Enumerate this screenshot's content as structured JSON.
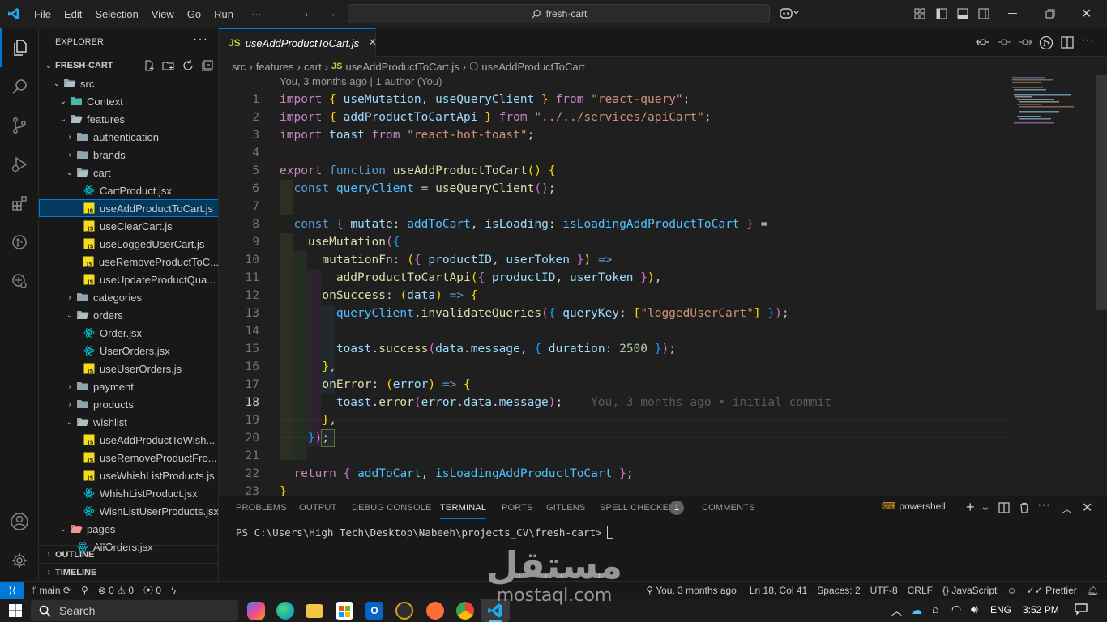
{
  "menu": [
    "File",
    "Edit",
    "Selection",
    "View",
    "Go",
    "Run",
    "···"
  ],
  "search": {
    "text": "fresh-cart"
  },
  "explorer": {
    "title": "EXPLORER",
    "project": "FRESH-CART",
    "outline": "OUTLINE",
    "timeline": "TIMELINE",
    "tree": [
      {
        "label": "src",
        "depth": 0,
        "type": "folder-open"
      },
      {
        "label": "Context",
        "depth": 1,
        "type": "folder-collapsed-ctx"
      },
      {
        "label": "features",
        "depth": 1,
        "type": "folder-open"
      },
      {
        "label": "authentication",
        "depth": 2,
        "type": "folder"
      },
      {
        "label": "brands",
        "depth": 2,
        "type": "folder"
      },
      {
        "label": "cart",
        "depth": 2,
        "type": "folder-open"
      },
      {
        "label": "CartProduct.jsx",
        "depth": 3,
        "type": "react"
      },
      {
        "label": "useAddProductToCart.js",
        "depth": 3,
        "type": "js",
        "selected": true
      },
      {
        "label": "useClearCart.js",
        "depth": 3,
        "type": "js"
      },
      {
        "label": "useLoggedUserCart.js",
        "depth": 3,
        "type": "js"
      },
      {
        "label": "useRemoveProductToC...",
        "depth": 3,
        "type": "js"
      },
      {
        "label": "useUpdateProductQua...",
        "depth": 3,
        "type": "js"
      },
      {
        "label": "categories",
        "depth": 2,
        "type": "folder"
      },
      {
        "label": "orders",
        "depth": 2,
        "type": "folder-open"
      },
      {
        "label": "Order.jsx",
        "depth": 3,
        "type": "react"
      },
      {
        "label": "UserOrders.jsx",
        "depth": 3,
        "type": "react"
      },
      {
        "label": "useUserOrders.js",
        "depth": 3,
        "type": "js"
      },
      {
        "label": "payment",
        "depth": 2,
        "type": "folder"
      },
      {
        "label": "products",
        "depth": 2,
        "type": "folder"
      },
      {
        "label": "wishlist",
        "depth": 2,
        "type": "folder-open"
      },
      {
        "label": "useAddProductToWish...",
        "depth": 3,
        "type": "js"
      },
      {
        "label": "useRemoveProductFro...",
        "depth": 3,
        "type": "js"
      },
      {
        "label": "useWhishListProducts.js",
        "depth": 3,
        "type": "js"
      },
      {
        "label": "WhishListProduct.jsx",
        "depth": 3,
        "type": "react"
      },
      {
        "label": "WishListUserProducts.jsx",
        "depth": 3,
        "type": "react"
      },
      {
        "label": "pages",
        "depth": 1,
        "type": "folder-open-pages"
      },
      {
        "label": "AllOrders.jsx",
        "depth": 2,
        "type": "react"
      }
    ]
  },
  "tab": {
    "label": "useAddProductToCart.js",
    "close": "×"
  },
  "breadcrumb": [
    "src",
    "features",
    "cart",
    "useAddProductToCart.js",
    "useAddProductToCart"
  ],
  "codelens": "You, 3 months ago | 1 author (You)",
  "code": {
    "line_numbers": [
      "1",
      "2",
      "3",
      "4",
      "5",
      "6",
      "7",
      "8",
      "9",
      "10",
      "11",
      "12",
      "13",
      "14",
      "15",
      "16",
      "17",
      "18",
      "19",
      "20",
      "21",
      "22",
      "23"
    ],
    "active_line": "18",
    "blame": "You, 3 months ago • initial commit"
  },
  "panel": {
    "tabs": [
      "PROBLEMS",
      "OUTPUT",
      "DEBUG CONSOLE",
      "TERMINAL",
      "PORTS",
      "GITLENS",
      "SPELL CHECKER",
      "COMMENTS"
    ],
    "spell_badge": "1",
    "shell": "powershell",
    "prompt": "PS C:\\Users\\High Tech\\Desktop\\Nabeeh\\projects_CV\\fresh-cart>"
  },
  "status": {
    "branch": "main",
    "errors": "0",
    "warnings": "0",
    "ports": "0",
    "blame": "You, 3 months ago",
    "position": "Ln 18, Col 41",
    "spaces": "Spaces: 2",
    "encoding": "UTF-8",
    "eol": "CRLF",
    "language": "JavaScript",
    "formatter": "Prettier"
  },
  "taskbar": {
    "search": "Search",
    "lang": "ENG",
    "time": "3:52 PM"
  },
  "watermark": {
    "arabic": "مستقل",
    "latin": "mostaql.com"
  },
  "colors": {
    "accent": "#0078d4",
    "statusRemote": "#0078d4"
  }
}
